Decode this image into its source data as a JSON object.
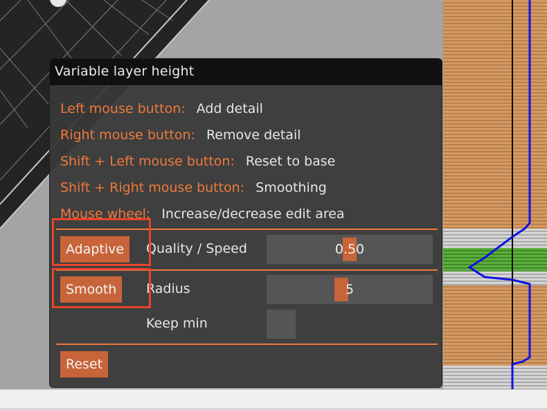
{
  "dialog": {
    "title": "Variable layer height",
    "help": [
      {
        "key": "Left mouse button:",
        "value": "Add detail"
      },
      {
        "key": "Right mouse button:",
        "value": "Remove detail"
      },
      {
        "key": "Shift + Left mouse button:",
        "value": "Reset to base"
      },
      {
        "key": "Shift + Right mouse button:",
        "value": "Smoothing"
      },
      {
        "key": "Mouse wheel:",
        "value": "Increase/decrease edit area"
      }
    ],
    "adaptive": {
      "button_label": "Adaptive",
      "label": "Quality / Speed",
      "value_text": "0.50",
      "value": 0.5
    },
    "smooth": {
      "button_label": "Smooth",
      "label": "Radius",
      "value_text": "5",
      "value": 5,
      "min": 1,
      "max": 10
    },
    "keep_min": {
      "label": "Keep min",
      "checked": false
    },
    "reset_label": "Reset"
  },
  "colors": {
    "accent": "#ee7a3b",
    "button": "#c8643a",
    "highlight": "#e8442a",
    "layer_profile": "#1010e0"
  }
}
